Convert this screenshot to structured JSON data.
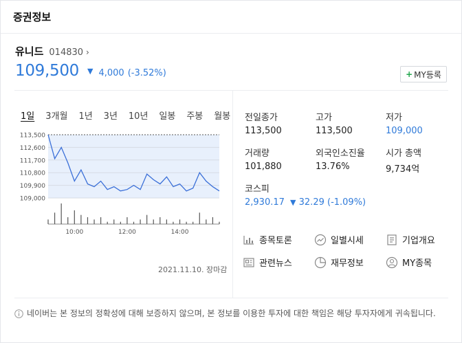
{
  "header": {
    "title": "증권정보"
  },
  "stock": {
    "name": "유니드",
    "code": "014830",
    "code_arrow": "›",
    "price": "109,500",
    "change_arrow": "▼",
    "change": "4,000",
    "change_rate": "(-3.52%)"
  },
  "my_button": {
    "plus": "+",
    "label": "MY등록"
  },
  "periods": [
    "1일",
    "3개월",
    "1년",
    "3년",
    "10년",
    "일봉",
    "주봉",
    "월봉"
  ],
  "chart_data": {
    "type": "line",
    "yticks": [
      "113,500",
      "112,600",
      "111,700",
      "110,800",
      "109,900",
      "109,000"
    ],
    "ylim": [
      109000,
      113500
    ],
    "xticks": [
      "10:00",
      "12:00",
      "14:00"
    ],
    "x": [
      "09:00",
      "09:15",
      "09:30",
      "09:45",
      "10:00",
      "10:15",
      "10:30",
      "10:45",
      "11:00",
      "11:15",
      "11:30",
      "11:45",
      "12:00",
      "12:15",
      "12:30",
      "12:45",
      "13:00",
      "13:15",
      "13:30",
      "13:45",
      "14:00",
      "14:15",
      "14:30",
      "14:45",
      "15:00",
      "15:15",
      "15:30"
    ],
    "values": [
      113500,
      111800,
      112600,
      111500,
      110200,
      111000,
      110000,
      109800,
      110200,
      109600,
      109800,
      109500,
      109600,
      109900,
      109600,
      110700,
      110300,
      110000,
      110500,
      109800,
      110000,
      109500,
      109700,
      110800,
      110200,
      109800,
      109500
    ],
    "volume": [
      2,
      5,
      9,
      3,
      6,
      4,
      3,
      2,
      3,
      1,
      2,
      1,
      3,
      1,
      2,
      4,
      2,
      3,
      2,
      1,
      2,
      1,
      1,
      5,
      2,
      3,
      1
    ],
    "colors": {
      "line": "#3a6fd8",
      "fill": "#e8f0fc",
      "volume": "#555555"
    }
  },
  "chart_date": "2021.11.10. 장마감",
  "stats": [
    {
      "label": "전일종가",
      "value": "113,500",
      "color": ""
    },
    {
      "label": "고가",
      "value": "113,500",
      "color": ""
    },
    {
      "label": "저가",
      "value": "109,000",
      "color": "#2f7ad9"
    },
    {
      "label": "거래량",
      "value": "101,880",
      "color": ""
    },
    {
      "label": "외국인소진율",
      "value": "13.76%",
      "color": ""
    },
    {
      "label": "시가 총액",
      "value": "9,734억",
      "color": ""
    }
  ],
  "kospi": {
    "label": "코스피",
    "value": "2,930.17",
    "arrow": "▼",
    "change": "32.29",
    "rate": "(-1.09%)"
  },
  "links": [
    {
      "label": "종목토론",
      "icon": "bar-chart-icon"
    },
    {
      "label": "일별시세",
      "icon": "trend-icon"
    },
    {
      "label": "기업개요",
      "icon": "document-icon"
    },
    {
      "label": "관련뉴스",
      "icon": "news-icon"
    },
    {
      "label": "재무정보",
      "icon": "pie-chart-icon"
    },
    {
      "label": "MY종목",
      "icon": "user-icon"
    }
  ],
  "notice": "네이버는 본 정보의 정확성에 대해 보증하지 않으며, 본 정보를 이용한 투자에 대한 책임은 해당 투자자에게 귀속됩니다."
}
